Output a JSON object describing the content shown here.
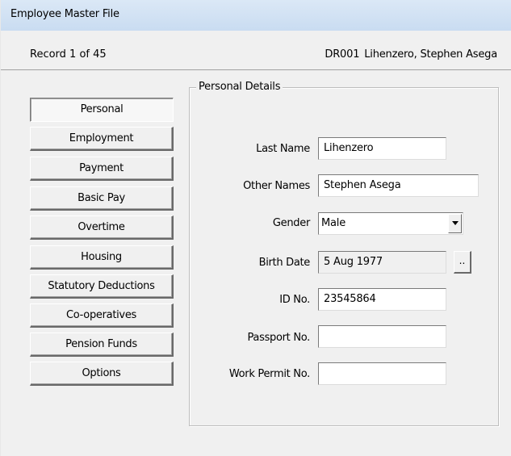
{
  "window": {
    "title": "Employee Master File"
  },
  "record": {
    "count_text": "Record 1 of 45",
    "employee_code": "DR001",
    "employee_name": "Lihenzero, Stephen Asega"
  },
  "nav": {
    "items": [
      {
        "label": "Personal",
        "active": true
      },
      {
        "label": "Employment"
      },
      {
        "label": "Payment"
      },
      {
        "label": "Basic Pay"
      },
      {
        "label": "Overtime"
      },
      {
        "label": "Housing"
      },
      {
        "label": "Statutory Deductions"
      },
      {
        "label": "Co-operatives"
      },
      {
        "label": "Pension Funds"
      },
      {
        "label": "Options"
      }
    ]
  },
  "personal_details": {
    "legend": "Personal Details",
    "last_name": {
      "label": "Last Name",
      "value": "Lihenzero"
    },
    "other_names": {
      "label": "Other Names",
      "value": "Stephen Asega"
    },
    "gender": {
      "label": "Gender",
      "value": "Male"
    },
    "birth_date": {
      "label": "Birth Date",
      "value": "5 Aug 1977",
      "picker_label": ".."
    },
    "id_no": {
      "label": "ID No.",
      "value": "23545864"
    },
    "passport_no": {
      "label": "Passport No.",
      "value": ""
    },
    "work_permit_no": {
      "label": "Work Permit No.",
      "value": ""
    }
  },
  "icons": {
    "dropdown": "chevron-down-icon"
  }
}
